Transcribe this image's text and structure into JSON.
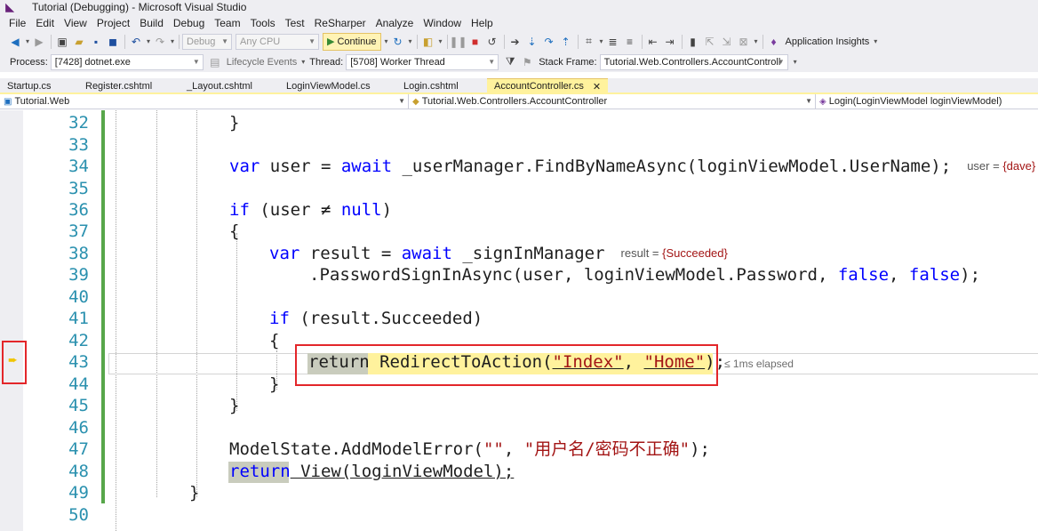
{
  "window": {
    "title": "Tutorial (Debugging) - Microsoft Visual Studio"
  },
  "menu": [
    "File",
    "Edit",
    "View",
    "Project",
    "Build",
    "Debug",
    "Team",
    "Tools",
    "Test",
    "ReSharper",
    "Analyze",
    "Window",
    "Help"
  ],
  "toolbar": {
    "config": "Debug",
    "platform": "Any CPU",
    "continue_label": "Continue",
    "app_insights": "Application Insights"
  },
  "debug_location": {
    "process_label": "Process:",
    "process": "[7428] dotnet.exe",
    "lifecycle_label": "Lifecycle Events",
    "thread_label": "Thread:",
    "thread": "[5708] Worker Thread",
    "stack_frame_label": "Stack Frame:",
    "stack_frame": "Tutorial.Web.Controllers.AccountControll"
  },
  "tabs": [
    {
      "label": "Startup.cs",
      "active": false
    },
    {
      "label": "Register.cshtml",
      "active": false
    },
    {
      "label": "_Layout.cshtml",
      "active": false
    },
    {
      "label": "LoginViewModel.cs",
      "active": false
    },
    {
      "label": "Login.cshtml",
      "active": false
    },
    {
      "label": "AccountController.cs",
      "active": true
    }
  ],
  "nav": {
    "project": "Tutorial.Web",
    "type": "Tutorial.Web.Controllers.AccountController",
    "member": "Login(LoginViewModel loginViewModel)"
  },
  "editor": {
    "line_numbers": [
      "32",
      "33",
      "34",
      "35",
      "36",
      "37",
      "38",
      "39",
      "40",
      "41",
      "42",
      "43",
      "44",
      "45",
      "46",
      "47",
      "48",
      "49",
      "50"
    ],
    "current_line": "43",
    "datatips": {
      "user_label": "user = ",
      "user_value": "{dave}",
      "result_label": "result = ",
      "result_value": "{Succeeded}"
    },
    "elapsed": "≤ 1ms elapsed",
    "code": {
      "l34_var": "var",
      "l34_mid": " user = ",
      "l34_await": "await",
      "l34_rest": " _userManager.FindByNameAsync(loginViewModel.UserName);",
      "l36_if": "if",
      "l36_rest1": " (user ",
      "l36_neq": "≠",
      "l36_null": " null",
      "l36_rest2": ")",
      "l38_var": "var",
      "l38_mid": " result = ",
      "l38_await": "await",
      "l38_rest": " _signInManager",
      "l39_rest": ".PasswordSignInAsync(user, loginViewModel.Password, ",
      "l39_false1": "false",
      "l39_comma": ", ",
      "l39_false2": "false",
      "l39_end": ");",
      "l41_if": "if",
      "l41_rest": " (result.Succeeded)",
      "l43_return": "return",
      "l43_call": " RedirectToAction(",
      "l43_s1": "\"Index\"",
      "l43_comma": ", ",
      "l43_s2": "\"Home\"",
      "l43_end": ");",
      "l47_call": "ModelState.AddModelError(",
      "l47_s1": "\"\"",
      "l47_comma": ", ",
      "l47_s2": "\"用户名/密码不正确\"",
      "l47_end": ");",
      "l48_return": "return",
      "l48_rest": " View(loginViewModel);",
      "open_brace": "{",
      "close_brace": "}"
    }
  }
}
